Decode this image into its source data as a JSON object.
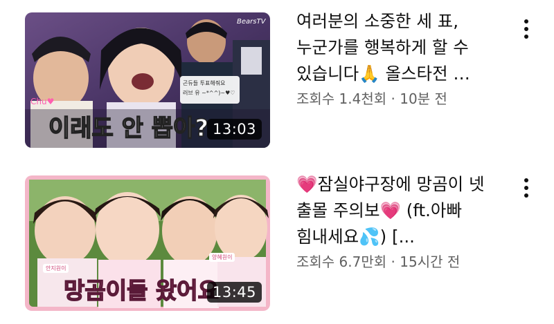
{
  "videos": [
    {
      "title": "여러분의 소중한 세 표, 누군가를 행복하게 할 수 있습니다🙏 올스타전 …",
      "views": "조회수 1.4천회",
      "separator": " · ",
      "age": "10분 전",
      "duration": "13:03",
      "thumbnail": {
        "caption": "이래도 안 뽑아?",
        "logo": "BearsTV",
        "sticker": "Chu♥",
        "bubble": [
          "곤듀들 투표해줘요",
          "러브 유 ~*^^)~♥♡"
        ]
      },
      "menu_icon": "more-vert-icon"
    },
    {
      "title": "💗잠실야구장에 망곰이 넷 출몰 주의보💗 (ft.아빠 힘내세요💦) [...",
      "views": "조회수 6.7만회",
      "separator": " · ",
      "age": "15시간 전",
      "duration": "13:45",
      "thumbnail": {
        "caption": "망곰이들 왔어요",
        "name_tag_left": "안지원이",
        "name_tag_right": "양혜원이",
        "border_color": "#f4b6c8"
      },
      "menu_icon": "more-vert-icon"
    }
  ],
  "colors": {
    "title": "#0f0f0f",
    "meta": "#606060",
    "duration_bg": "#000000"
  }
}
